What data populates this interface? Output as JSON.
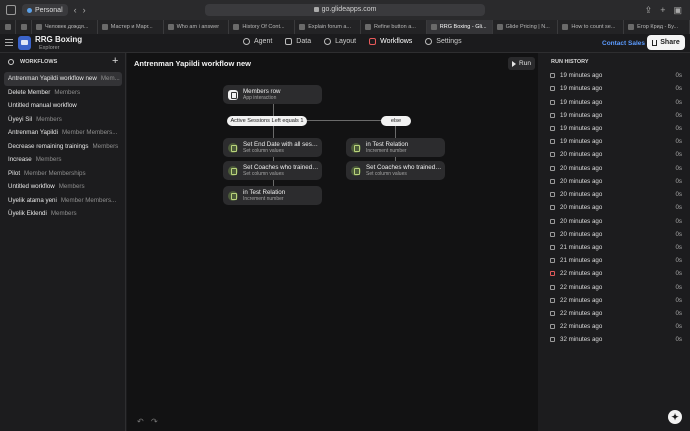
{
  "browser": {
    "profile": "Personal",
    "url": "go.glideapps.com",
    "tabs": [
      {
        "label": "",
        "pinned": true
      },
      {
        "label": "",
        "pinned": true
      },
      {
        "label": "Человек дождя..."
      },
      {
        "label": "Мастер и Марг..."
      },
      {
        "label": "Who am i answer"
      },
      {
        "label": "History Of Cont..."
      },
      {
        "label": "Explain forum a..."
      },
      {
        "label": "Refine button a..."
      },
      {
        "label": "RRG Boxing - Gli...",
        "active": true
      },
      {
        "label": "Glide Pricing | N..."
      },
      {
        "label": "How to count se..."
      },
      {
        "label": "Егор Крид - Бу..."
      }
    ]
  },
  "header": {
    "app_name": "RRG Boxing",
    "app_subtitle": "Explorer",
    "nav": [
      {
        "label": "Agent",
        "icon": "agent-icon"
      },
      {
        "label": "Data",
        "icon": "data-icon"
      },
      {
        "label": "Layout",
        "icon": "layout-icon"
      },
      {
        "label": "Workflows",
        "icon": "workflows-icon",
        "active": true
      },
      {
        "label": "Settings",
        "icon": "settings-icon"
      }
    ],
    "contact_label": "Contact Sales",
    "share_label": "Share"
  },
  "sidebar": {
    "title": "WORKFLOWS",
    "items": [
      {
        "name": "Antrenman Yapildi workflow new",
        "sub": "Mem...",
        "active": true
      },
      {
        "name": "Delete Member",
        "sub": "Members"
      },
      {
        "name": "Untitled manual workflow",
        "sub": ""
      },
      {
        "name": "Üyeyi Sil",
        "sub": "Members"
      },
      {
        "name": "Antrenman Yapildi",
        "sub": "Member Members..."
      },
      {
        "name": "Decrease remaining trainings",
        "sub": "Members"
      },
      {
        "name": "Increase",
        "sub": "Members"
      },
      {
        "name": "Pilot",
        "sub": "Member Memberships"
      },
      {
        "name": "Untitled workflow",
        "sub": "Members"
      },
      {
        "name": "Uyelik atama yeni",
        "sub": "Member Members..."
      },
      {
        "name": "Üyelik Eklendi",
        "sub": "Members"
      }
    ]
  },
  "canvas": {
    "title": "Antrenman Yapildi workflow new",
    "run_label": "Run",
    "trigger": {
      "title": "Members row",
      "subtitle": "App interaction"
    },
    "condition_label": "Active Sessions Left equals 1",
    "else_label": "else",
    "left_branch": [
      {
        "title": "Set End Date with all sessio...",
        "subtitle": "Set column values"
      },
      {
        "title": "Set Coaches who trained th...",
        "subtitle": "Set column values"
      },
      {
        "title": "in Test Relation",
        "subtitle": "Increment number"
      }
    ],
    "right_branch": [
      {
        "title": "in Test Relation",
        "subtitle": "Increment number"
      },
      {
        "title": "Set Coaches who trained th...",
        "subtitle": "Set column values"
      }
    ]
  },
  "history": {
    "title": "RUN HISTORY",
    "rows": [
      {
        "time": "19 minutes ago",
        "dur": "0s"
      },
      {
        "time": "19 minutes ago",
        "dur": "0s"
      },
      {
        "time": "19 minutes ago",
        "dur": "0s"
      },
      {
        "time": "19 minutes ago",
        "dur": "0s"
      },
      {
        "time": "19 minutes ago",
        "dur": "0s"
      },
      {
        "time": "19 minutes ago",
        "dur": "0s"
      },
      {
        "time": "20 minutes ago",
        "dur": "0s"
      },
      {
        "time": "20 minutes ago",
        "dur": "0s"
      },
      {
        "time": "20 minutes ago",
        "dur": "0s"
      },
      {
        "time": "20 minutes ago",
        "dur": "0s"
      },
      {
        "time": "20 minutes ago",
        "dur": "0s"
      },
      {
        "time": "20 minutes ago",
        "dur": "0s"
      },
      {
        "time": "20 minutes ago",
        "dur": "0s"
      },
      {
        "time": "21 minutes ago",
        "dur": "0s"
      },
      {
        "time": "21 minutes ago",
        "dur": "0s"
      },
      {
        "time": "22 minutes ago",
        "dur": "0s",
        "error": true
      },
      {
        "time": "22 minutes ago",
        "dur": "0s"
      },
      {
        "time": "22 minutes ago",
        "dur": "0s"
      },
      {
        "time": "22 minutes ago",
        "dur": "0s"
      },
      {
        "time": "22 minutes ago",
        "dur": "0s"
      },
      {
        "time": "32 minutes ago",
        "dur": "0s"
      }
    ]
  },
  "colors": {
    "accent_link": "#5b9bff",
    "workflows_active": "#e85a5a",
    "step_icon": "#b9d37b"
  }
}
